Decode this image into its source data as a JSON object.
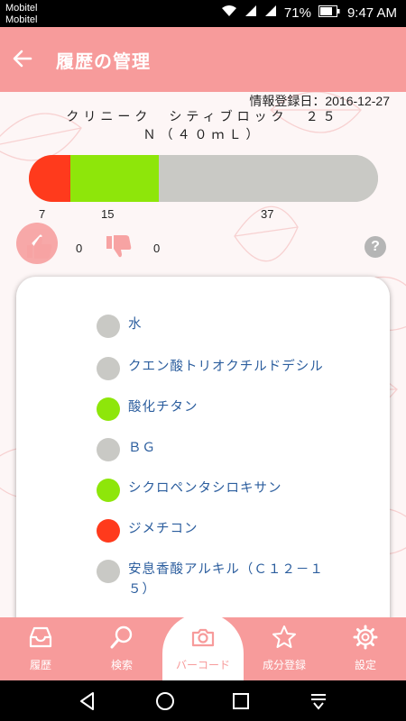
{
  "status_bar": {
    "carrier_line1": "Mobitel",
    "carrier_line2": "Mobitel",
    "battery_percent": "71%",
    "time": "9:47 AM"
  },
  "app_bar": {
    "title": "履歴の管理",
    "back_icon": "arrow-left-icon"
  },
  "product": {
    "registration_label": "情報登録日：",
    "registration_date": "2016-12-27",
    "name": "クリニーク　シティブロック　２５　Ｎ（４０ｍＬ）"
  },
  "rating_bar": {
    "colors": {
      "red": "#ff3a1c",
      "green": "#8ee60a",
      "gray": "#c9c9c5"
    },
    "segments": [
      {
        "color": "red",
        "count": "7"
      },
      {
        "color": "green",
        "count": "15"
      },
      {
        "color": "gray",
        "count": "37"
      }
    ]
  },
  "feedback": {
    "like_count": "0",
    "dislike_count": "0",
    "help_label": "?"
  },
  "ingredients": [
    {
      "name": "水",
      "status": "gray"
    },
    {
      "name": "クエン酸トリオクチルドデシル",
      "status": "gray"
    },
    {
      "name": "酸化チタン",
      "status": "green"
    },
    {
      "name": "ＢＧ",
      "status": "gray"
    },
    {
      "name": "シクロペンタシロキサン",
      "status": "green"
    },
    {
      "name": "ジメチコン",
      "status": "red"
    },
    {
      "name": "安息香酸アルキル（Ｃ１２－１５）",
      "status": "gray"
    }
  ],
  "bottom_nav": [
    {
      "label": "履歴",
      "icon": "inbox-tray-icon"
    },
    {
      "label": "検索",
      "icon": "search-icon"
    },
    {
      "label": "バーコード",
      "icon": "camera-icon",
      "active": true
    },
    {
      "label": "成分登録",
      "icon": "star-icon"
    },
    {
      "label": "設定",
      "icon": "gear-icon"
    }
  ],
  "theme": {
    "accent": "#f79b9b",
    "link": "#2c5e9e"
  }
}
